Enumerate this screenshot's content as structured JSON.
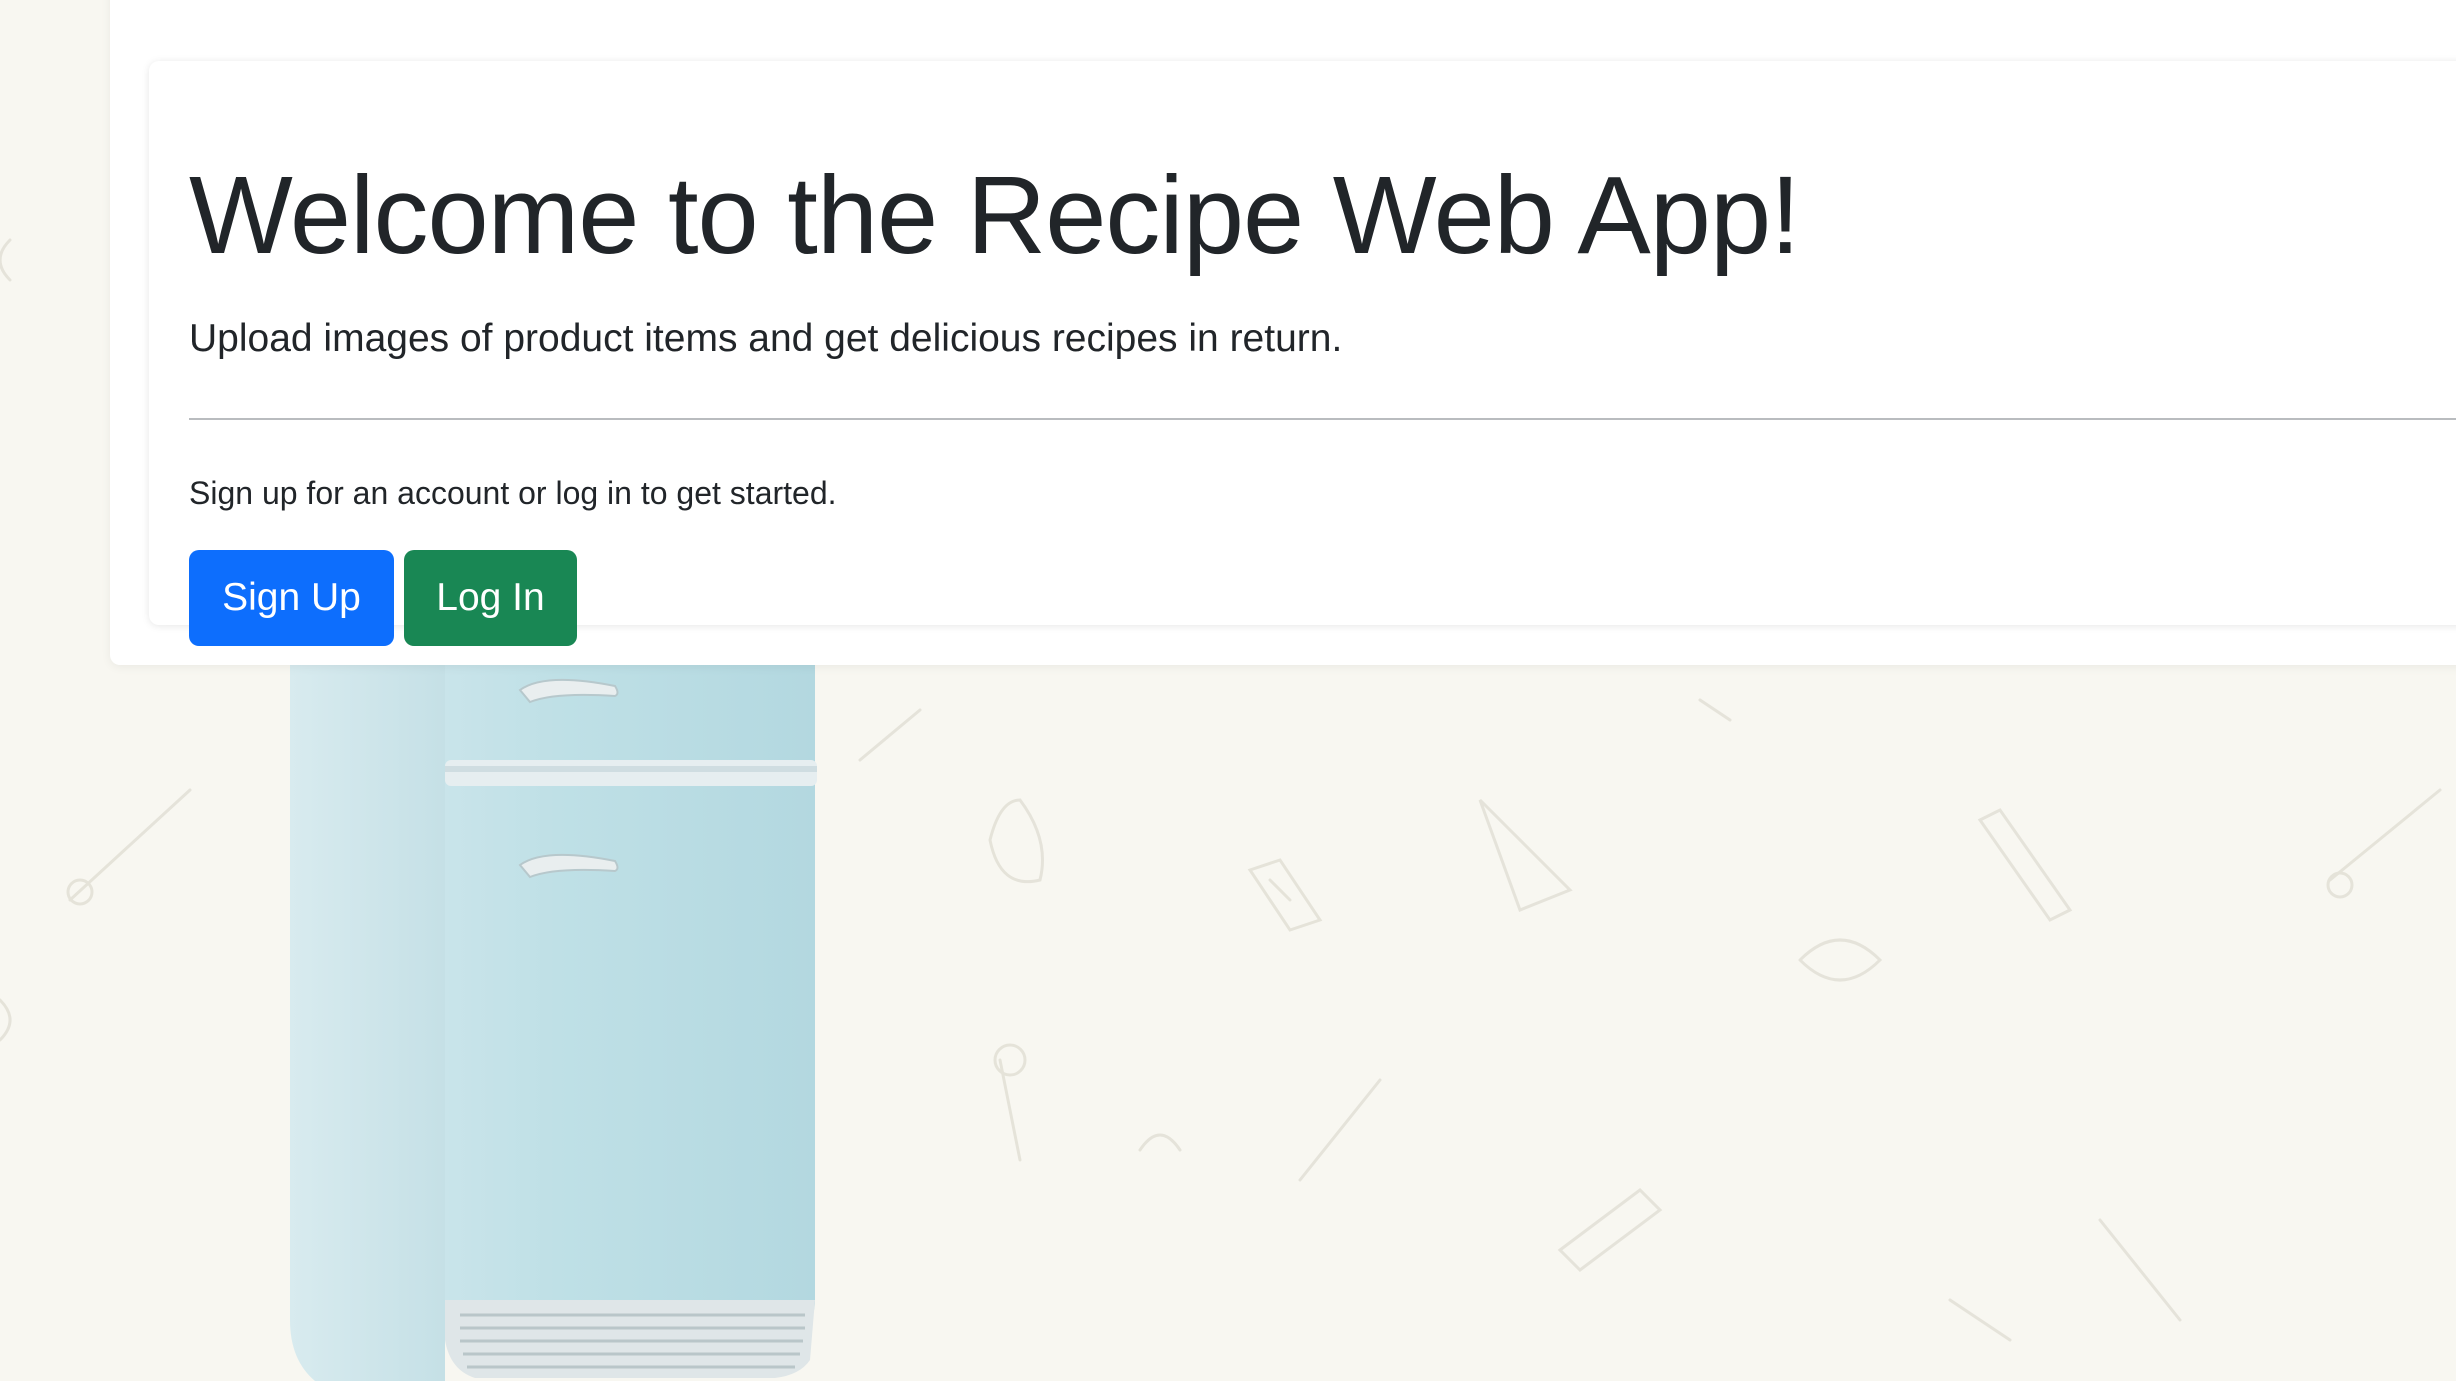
{
  "hero": {
    "title": "Welcome to the Recipe Web App!",
    "lead": "Upload images of product items and get delicious recipes in return.",
    "prompt": "Sign up for an account or log in to get started."
  },
  "actions": {
    "signup_label": "Sign Up",
    "login_label": "Log In"
  },
  "colors": {
    "primary": "#0d6efd",
    "success": "#198754",
    "page_background": "#f8f7f1",
    "fridge": "#bfe3ea"
  },
  "background": {
    "image": "kitchen-utensil-doodle-pattern with retro-fridge"
  }
}
